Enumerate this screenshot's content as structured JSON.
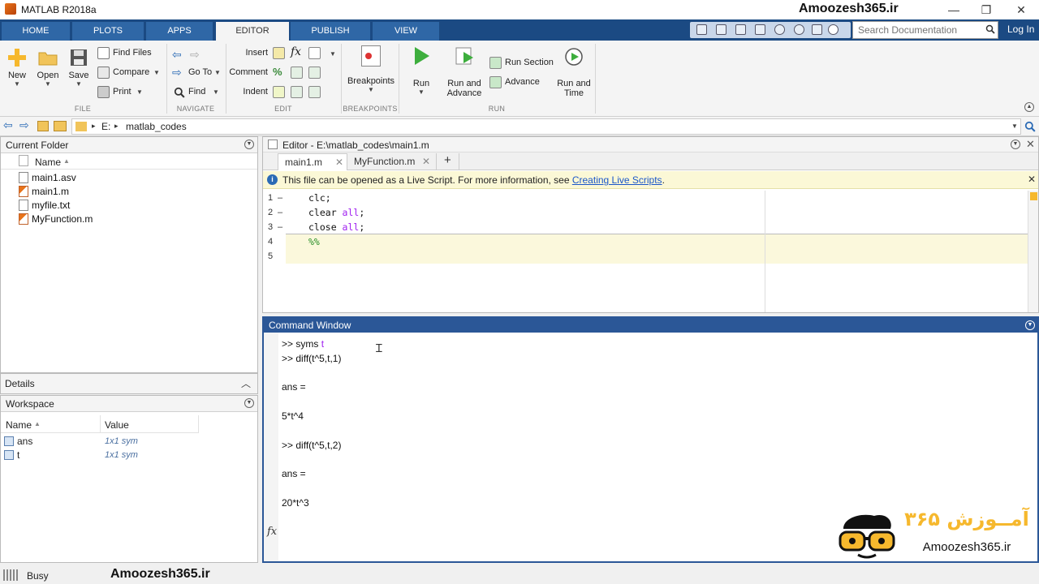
{
  "window": {
    "title": "MATLAB R2018a",
    "watermark": "Amoozesh365.ir"
  },
  "tabs": [
    {
      "label": "HOME"
    },
    {
      "label": "PLOTS"
    },
    {
      "label": "APPS"
    },
    {
      "label": "EDITOR"
    },
    {
      "label": "PUBLISH"
    },
    {
      "label": "VIEW"
    }
  ],
  "search": {
    "placeholder": "Search Documentation"
  },
  "login": "Log In",
  "ribbon": {
    "file": {
      "group": "FILE",
      "new": "New",
      "open": "Open",
      "save": "Save",
      "find_files": "Find Files",
      "compare": "Compare",
      "print": "Print"
    },
    "navigate": {
      "group": "NAVIGATE",
      "go_to": "Go To",
      "find": "Find"
    },
    "edit": {
      "group": "EDIT",
      "insert": "Insert",
      "comment": "Comment",
      "indent": "Indent",
      "fx": "fx"
    },
    "breakpoints": {
      "group": "BREAKPOINTS",
      "label": "Breakpoints"
    },
    "run": {
      "group": "RUN",
      "run": "Run",
      "run_and_advance_1": "Run and",
      "run_and_advance_2": "Advance",
      "run_section": "Run Section",
      "advance": "Advance",
      "run_and_time_1": "Run and",
      "run_and_time_2": "Time"
    }
  },
  "address": {
    "drive": "E:",
    "folder": "matlab_codes",
    "sep": "▸"
  },
  "current_folder": {
    "title": "Current Folder",
    "col_name": "Name",
    "files": [
      {
        "name": "main1.asv"
      },
      {
        "name": "main1.m"
      },
      {
        "name": "myfile.txt"
      },
      {
        "name": "MyFunction.m"
      }
    ]
  },
  "details": {
    "title": "Details"
  },
  "workspace": {
    "title": "Workspace",
    "col_name": "Name",
    "col_value": "Value",
    "vars": [
      {
        "name": "ans",
        "value": "1x1 sym"
      },
      {
        "name": "t",
        "value": "1x1 sym"
      }
    ]
  },
  "editor": {
    "title": "Editor - E:\\matlab_codes\\main1.m",
    "tabs": [
      {
        "label": "main1.m"
      },
      {
        "label": "MyFunction.m"
      }
    ],
    "add_tab": "+",
    "info_text": "This file can be opened as a Live Script. For more information, see ",
    "info_link": "Creating Live Scripts",
    "info_end": ".",
    "lines": [
      {
        "num": "1",
        "marker": "–",
        "code": "clc;",
        "kw": "",
        "tail": ""
      },
      {
        "num": "2",
        "marker": "–",
        "code": "clear ",
        "kw": "all",
        "tail": ";"
      },
      {
        "num": "3",
        "marker": "–",
        "code": "close ",
        "kw": "all",
        "tail": ";"
      },
      {
        "num": "4",
        "marker": "",
        "code": "",
        "kw": "",
        "tail": "",
        "comment": "%%"
      },
      {
        "num": "5",
        "marker": "",
        "code": "",
        "kw": "",
        "tail": ""
      }
    ]
  },
  "command_window": {
    "title": "Command Window",
    "lines": [
      {
        "prompt": ">> ",
        "cmd": "syms ",
        "arg": "t"
      },
      {
        "prompt": ">> ",
        "cmd": "diff(t^5,t,1)",
        "arg": ""
      },
      {
        "prompt": "",
        "cmd": "",
        "arg": ""
      },
      {
        "prompt": "",
        "cmd": "ans =",
        "arg": ""
      },
      {
        "prompt": "",
        "cmd": "",
        "arg": ""
      },
      {
        "prompt": "",
        "cmd": "5*t^4",
        "arg": ""
      },
      {
        "prompt": "",
        "cmd": "",
        "arg": ""
      },
      {
        "prompt": ">> ",
        "cmd": "diff(t^5,t,2)",
        "arg": ""
      },
      {
        "prompt": "",
        "cmd": "",
        "arg": ""
      },
      {
        "prompt": "",
        "cmd": "ans =",
        "arg": ""
      },
      {
        "prompt": "",
        "cmd": "",
        "arg": ""
      },
      {
        "prompt": "",
        "cmd": "20*t^3",
        "arg": ""
      }
    ],
    "fx": "fx"
  },
  "logo": {
    "persian": "آمــوزش ۳۶۵",
    "latin": "Amoozesh365.ir"
  },
  "status": {
    "text": "Busy",
    "watermark": "Amoozesh365.ir"
  },
  "colors": {
    "tabbar": "#1b4a83",
    "tab": "#2f67a6",
    "cmd_border": "#2b5797",
    "info_bar": "#fbf8d6",
    "keyword": "#a020f0",
    "comment": "#228b22"
  }
}
